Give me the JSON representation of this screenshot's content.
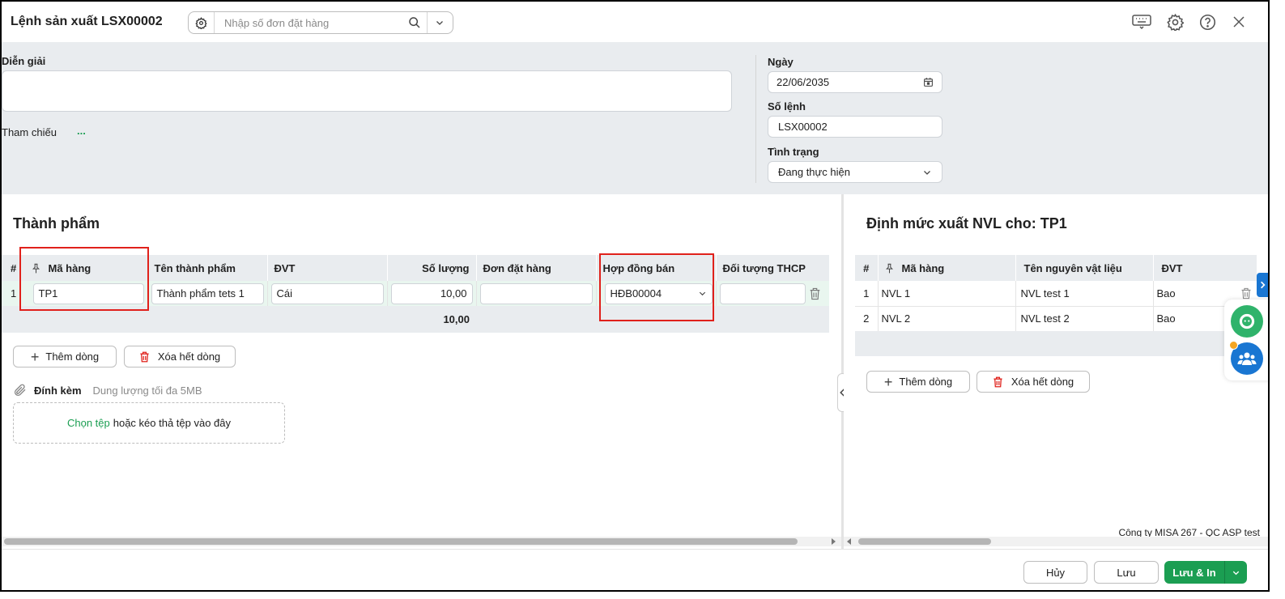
{
  "window": {
    "title": "Lệnh sản xuất LSX00002",
    "search_placeholder": "Nhập số đơn đặt hàng",
    "icons": [
      "gear-icon",
      "search-icon",
      "chevron-down-icon",
      "keyboard-icon",
      "settings-icon",
      "help-icon",
      "close-icon"
    ]
  },
  "info": {
    "description_label": "Diễn giải",
    "description_value": "",
    "reference_label": "Tham chiếu",
    "reference_link": "...",
    "date_label": "Ngày",
    "date_value": "22/06/2035",
    "order_no_label": "Số lệnh",
    "order_no_value": "LSX00002",
    "status_label": "Tình trạng",
    "status_value": "Đang thực hiện"
  },
  "products": {
    "title": "Thành phẩm",
    "columns": [
      "#",
      "Mã hàng",
      "Tên thành phẩm",
      "ĐVT",
      "Số lượng",
      "Đơn đặt hàng",
      "Hợp đồng bán",
      "Đối tượng THCP"
    ],
    "rows": [
      {
        "no": "1",
        "code": "TP1",
        "name": "Thành phẩm tets 1",
        "unit": "Cái",
        "qty": "10,00",
        "sales_order": "",
        "contract": "HĐB00004",
        "cost_object": ""
      }
    ],
    "total_qty": "10,00",
    "add_row": "Thêm dòng",
    "clear_rows": "Xóa hết dòng",
    "attach_label": "Đính kèm",
    "attach_hint": "Dung lượng tối đa 5MB",
    "choose_file": "Chọn tệp",
    "drop_hint": "hoặc kéo thả tệp vào đây"
  },
  "materials": {
    "title": "Định mức xuất NVL cho: TP1",
    "columns": [
      "#",
      "Mã hàng",
      "Tên nguyên vật liệu",
      "ĐVT"
    ],
    "rows": [
      {
        "no": "1",
        "code": "NVL 1",
        "name": "NVL test 1",
        "unit": "Bao"
      },
      {
        "no": "2",
        "code": "NVL 2",
        "name": "NVL test 2",
        "unit": "Bao"
      }
    ],
    "add_row": "Thêm dòng",
    "clear_rows": "Xóa hết dòng"
  },
  "company": "Công ty MISA 267 - QC ASP test",
  "footer": {
    "cancel": "Hủy",
    "save": "Lưu",
    "save_print": "Lưu & In"
  },
  "colors": {
    "primary": "#1b9e52",
    "highlight": "#e0211b",
    "header_bg": "#e9ecef",
    "chat_green": "#2fb36b",
    "community_blue": "#1976d2"
  }
}
